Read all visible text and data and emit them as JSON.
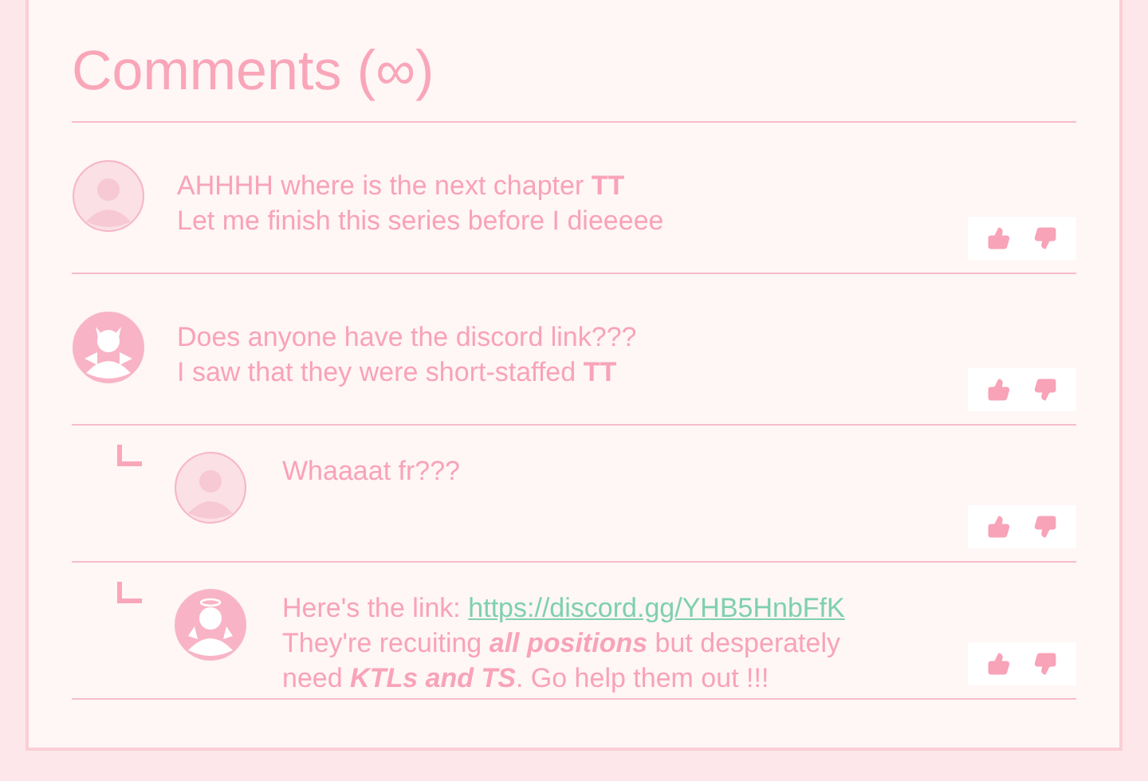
{
  "title": "Comments (∞)",
  "comments": [
    {
      "kind": "plain",
      "reply": false,
      "lines": [
        {
          "text": "AHHHH where is the next chapter **TT**"
        },
        {
          "text": "Let me finish this series before I dieeeee"
        }
      ]
    },
    {
      "kind": "devil",
      "reply": false,
      "lines": [
        {
          "text": "Does anyone have the discord link???"
        },
        {
          "text": "I saw that they were short-staffed **TT**"
        }
      ]
    },
    {
      "kind": "plain",
      "reply": true,
      "lines": [
        {
          "text": "Whaaaat fr???"
        }
      ]
    },
    {
      "kind": "angel",
      "reply": true,
      "lines": [
        {
          "text": "Here's the link:",
          "link": "https://discord.gg/YHB5HnbFfK"
        },
        {
          "text": "They're recuiting *all positions* but desperately"
        },
        {
          "text": "need *KTLs and TS*. Go help them out !!!"
        }
      ]
    }
  ]
}
